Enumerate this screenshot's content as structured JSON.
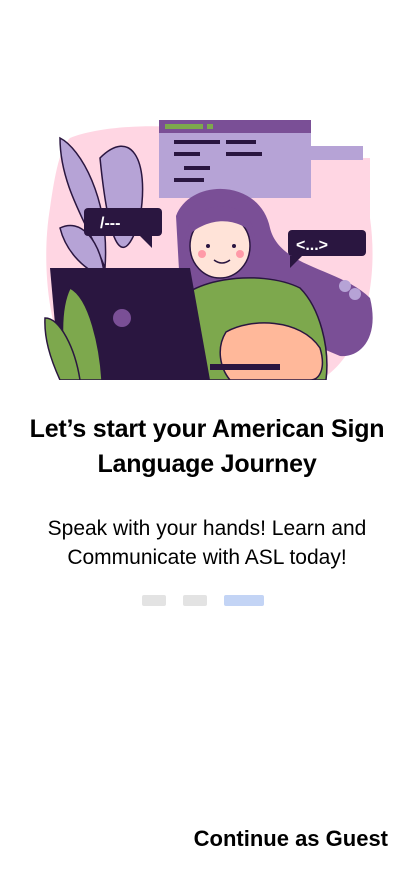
{
  "onboarding": {
    "headline": "Let’s start your American Sign Language Journey",
    "subtext": "Speak with your hands! Learn and Communicate with ASL today!",
    "page_indicator": {
      "total": 3,
      "active_index": 2
    },
    "continue_guest_label": "Continue as Guest"
  },
  "illustration": {
    "icon": "woman-at-laptop-illustration",
    "bubble_left_text": "/---",
    "bubble_right_text": "<...>"
  },
  "colors": {
    "background": "#ffffff",
    "text": "#000000",
    "indicator_inactive": "#e3e3e3",
    "indicator_active": "#c3d4f5",
    "accent_purple": "#7a4f96",
    "accent_pink": "#ffd6e3",
    "accent_green": "#7da84d"
  }
}
